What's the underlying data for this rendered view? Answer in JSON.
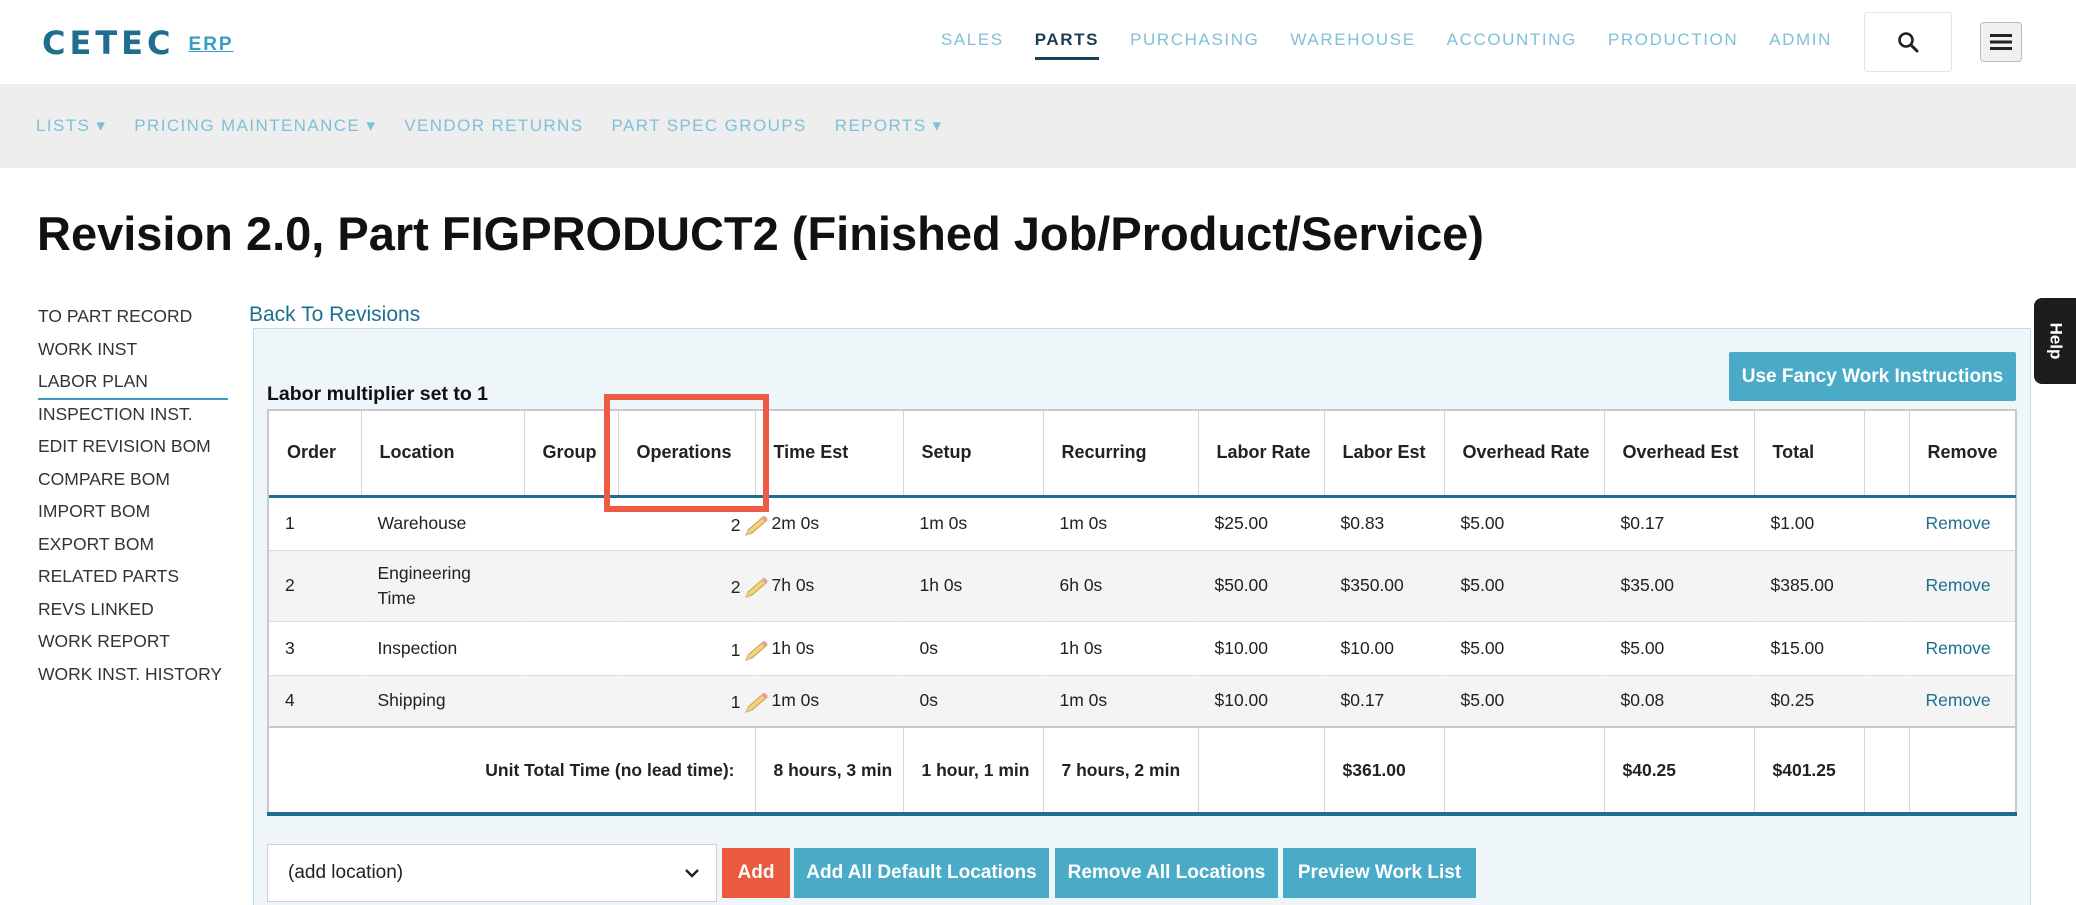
{
  "header": {
    "logo_main": "CETEC",
    "logo_sub": "ERP",
    "nav": [
      "SALES",
      "PARTS",
      "PURCHASING",
      "WAREHOUSE",
      "ACCOUNTING",
      "PRODUCTION",
      "ADMIN"
    ],
    "active_nav": "PARTS"
  },
  "subnav": [
    "LISTS ▾",
    "PRICING MAINTENANCE ▾",
    "VENDOR RETURNS",
    "PART SPEC GROUPS",
    "REPORTS ▾"
  ],
  "page": {
    "title": "Revision 2.0, Part FIGPRODUCT2 (Finished Job/Product/Service)",
    "back_link": "Back To Revisions",
    "multiplier_text": "Labor multiplier set to 1",
    "fancy_button": "Use Fancy Work Instructions",
    "help": "Help"
  },
  "left_nav": [
    "TO PART RECORD",
    "WORK INST",
    "LABOR PLAN",
    "INSPECTION INST.",
    "EDIT REVISION BOM",
    "COMPARE BOM",
    "IMPORT BOM",
    "EXPORT BOM",
    "RELATED PARTS",
    "REVS LINKED",
    "WORK REPORT",
    "WORK INST. HISTORY"
  ],
  "table": {
    "headers": [
      "Order",
      "Location",
      "Group",
      "Operations",
      "Time Est",
      "Setup",
      "Recurring",
      "Labor Rate",
      "Labor Est",
      "Overhead Rate",
      "Overhead Est",
      "Total",
      "",
      "Remove"
    ],
    "rows": [
      {
        "order": "1",
        "location": "Warehouse",
        "group": "",
        "operations": "2",
        "time_est": "2m 0s",
        "setup": "1m 0s",
        "recurring": "1m 0s",
        "labor_rate": "$25.00",
        "labor_est": "$0.83",
        "overhead_rate": "$5.00",
        "overhead_est": "$0.17",
        "total": "$1.00",
        "remove": "Remove"
      },
      {
        "order": "2",
        "location": "Engineering Time",
        "group": "",
        "operations": "2",
        "time_est": "7h 0s",
        "setup": "1h 0s",
        "recurring": "6h 0s",
        "labor_rate": "$50.00",
        "labor_est": "$350.00",
        "overhead_rate": "$5.00",
        "overhead_est": "$35.00",
        "total": "$385.00",
        "remove": "Remove"
      },
      {
        "order": "3",
        "location": "Inspection",
        "group": "",
        "operations": "1",
        "time_est": "1h 0s",
        "setup": "0s",
        "recurring": "1h 0s",
        "labor_rate": "$10.00",
        "labor_est": "$10.00",
        "overhead_rate": "$5.00",
        "overhead_est": "$5.00",
        "total": "$15.00",
        "remove": "Remove"
      },
      {
        "order": "4",
        "location": "Shipping",
        "group": "",
        "operations": "1",
        "time_est": "1m 0s",
        "setup": "0s",
        "recurring": "1m 0s",
        "labor_rate": "$10.00",
        "labor_est": "$0.17",
        "overhead_rate": "$5.00",
        "overhead_est": "$0.08",
        "total": "$0.25",
        "remove": "Remove"
      }
    ],
    "footer": {
      "label": "Unit Total Time (no lead time):",
      "time_est": "8 hours, 3 min",
      "setup": "1 hour, 1 min",
      "recurring": "7 hours, 2 min",
      "labor_est": "$361.00",
      "overhead_est": "$40.25",
      "total": "$401.25"
    }
  },
  "controls": {
    "location_select": "(add location)",
    "add": "Add",
    "add_all": "Add All Default Locations",
    "remove_all": "Remove All Locations",
    "preview": "Preview Work List"
  },
  "colors": {
    "brand": "#1e6f8f",
    "accent_button": "#4aabc8",
    "add_button": "#e95a3f",
    "highlight": "#ec5b43"
  }
}
